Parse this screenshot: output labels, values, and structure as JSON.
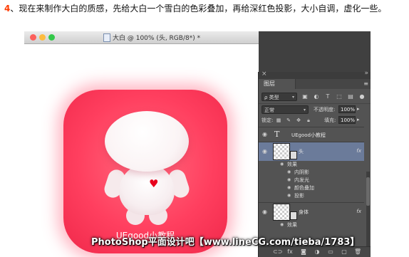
{
  "caption": {
    "number": "4",
    "text": "、现在来制作大白的质感，先给大白一个雪白的色彩叠加，再给深红色投影，大小自调，虚化一些。"
  },
  "document": {
    "title": "大白 @ 100% (头, RGB/8*) *"
  },
  "canvas": {
    "icon_label": "UEgood小教程"
  },
  "layers_panel": {
    "close_glyph": "×",
    "collapse_glyph": "»",
    "menu_glyph": "≡",
    "tab_label": "图层",
    "filter_select": "ρ 类型",
    "blend_mode": "正常",
    "opacity_label": "不透明度:",
    "opacity_value": "100%",
    "lock_label": "锁定:",
    "fill_label": "填充:",
    "fill_value": "100%",
    "layers": [
      {
        "name": "UEgood小教程",
        "type": "text"
      },
      {
        "name": "头",
        "type": "image",
        "fx": "fx",
        "effects_label": "效果",
        "effects": [
          "内阴影",
          "内发光",
          "颜色叠加",
          "投影"
        ]
      },
      {
        "name": "身体",
        "type": "image",
        "fx": "fx",
        "effects_label": "效果"
      }
    ]
  },
  "watermark": "PhotoShop平面设计吧【www.lineCG.com/tieba/1783】",
  "colors": {
    "accent_red": "#ff3f5f",
    "panel_bg": "#535353",
    "selected_layer": "#6b7b9a",
    "heart": "#e8001c"
  }
}
